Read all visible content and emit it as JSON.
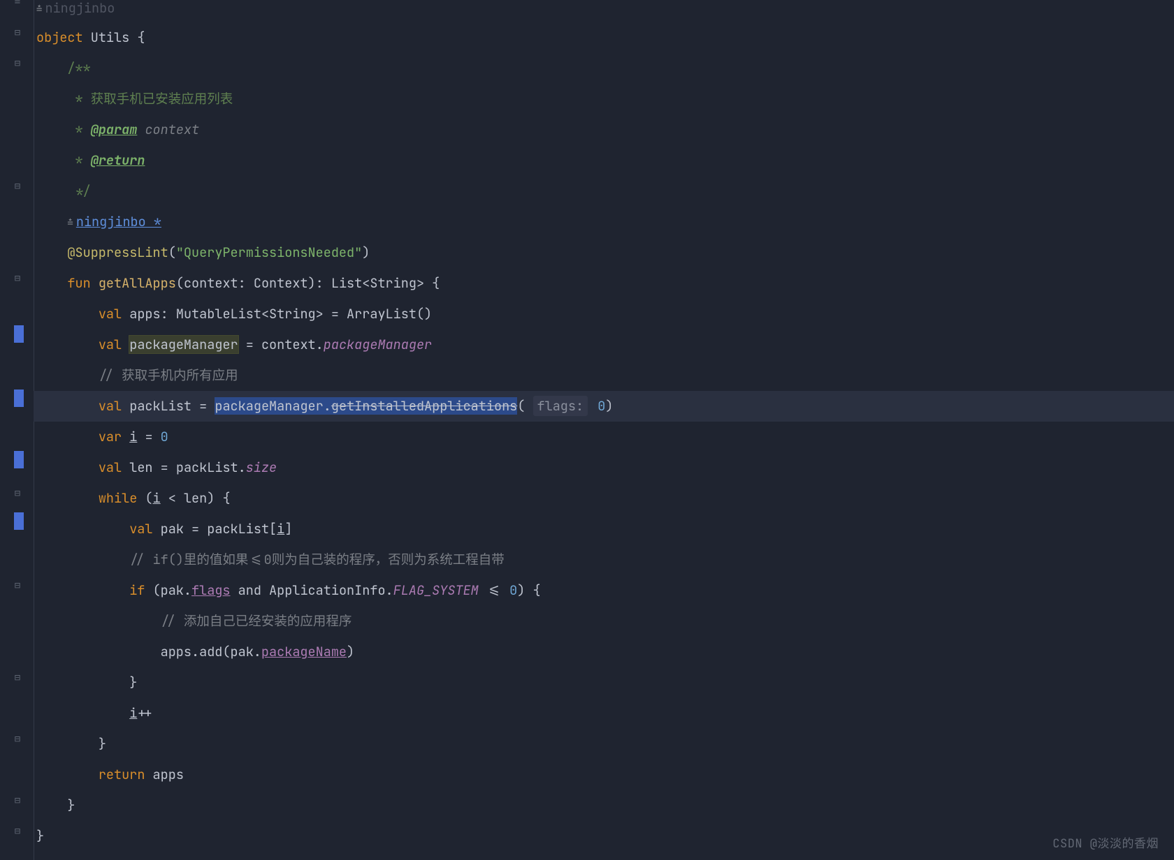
{
  "author_top": "ningjinbo",
  "author_link": "ningjinbo *",
  "obj_kw": "object",
  "obj_name": "Utils",
  "doc_open": "/**",
  "doc_l1_star": " * ",
  "doc_l1_text": "获取手机已安装应用列表",
  "doc_at_param": "@param",
  "doc_param_name": "context",
  "doc_at_return": "@return",
  "doc_close": " */",
  "anno_name": "@SuppressLint",
  "anno_arg": "\"QueryPermissionsNeeded\"",
  "fun_kw": "fun",
  "fun_name": "getAllApps",
  "fun_sig_open": "(context: Context): List<String> {",
  "val_kw": "val",
  "var_kw": "var",
  "apps": "apps",
  "apps_type": ": MutableList<String> = ArrayList()",
  "pm_var": "packageManager",
  "pm_assign": " = context.",
  "pm_prop": "packageManager",
  "c_all_apps": "// 获取手机内所有应用",
  "packList": "packList",
  "pl_assign": " = ",
  "pl_sel": "packageManager.",
  "pl_strike": "getInstalledApplications",
  "pl_open": "(",
  "hint_flags": "flags:",
  "zero": "0",
  "pl_close": ")",
  "i_var": "i",
  "i_assign": " = ",
  "len": "len",
  "len_assign": " = packList.",
  "size_prop": "size",
  "while_kw": "while",
  "while_cond_open": " (",
  "while_i": "i",
  "while_rest": " < len) {",
  "pak": "pak",
  "pak_assign": " = packList[",
  "pak_i": "i",
  "pak_close": "]",
  "c_if": "// if()里的值如果<=0则为自己装的程序，否则为系统工程自带",
  "if_kw": "if",
  "if_open": " (pak.",
  "flags_u": "flags",
  "if_and": " and ",
  "if_ai": "ApplicationInfo.",
  "flag_sys": "FLAG_SYSTEM",
  "if_tail": " <= ",
  "if_zero": "0",
  "if_close": ") {",
  "c_add": "// 添加自己已经安装的应用程序",
  "apps_add": "apps.add(pak.",
  "pkg_name": "packageName",
  "apps_add_close": ")",
  "brace_close": "}",
  "ipp_i": "i",
  "ipp": "++",
  "return_kw": "return",
  "return_apps": " apps",
  "watermark": "CSDN @淡淡的香烟"
}
